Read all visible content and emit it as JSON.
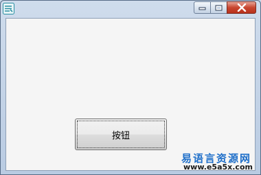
{
  "window": {
    "icon": "app-logo-icon",
    "controls": {
      "minimize_icon": "minimize-icon",
      "maximize_icon": "maximize-icon",
      "close_icon": "close-icon"
    }
  },
  "main": {
    "button_label": "按钮"
  },
  "watermark": {
    "text": "易语言资源网",
    "url": "www.e5a5x.com"
  },
  "colors": {
    "accent": "#1f6fc9",
    "close": "#c8452f",
    "client_bg": "#f5f5f5"
  }
}
